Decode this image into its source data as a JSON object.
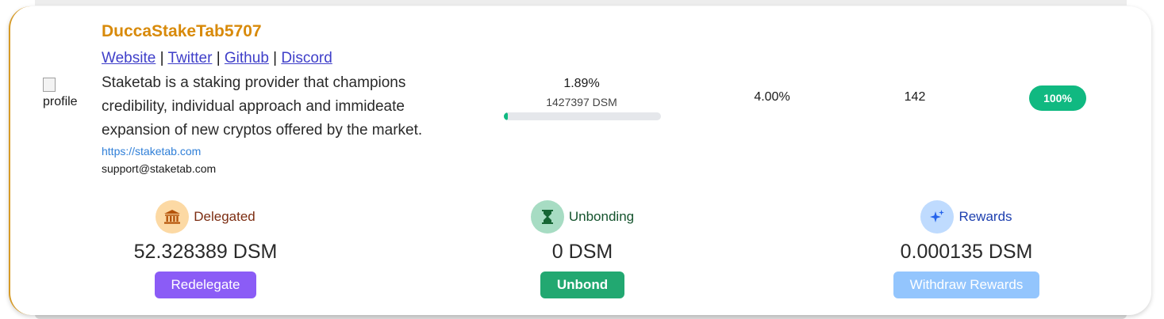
{
  "validator": {
    "profile_alt": "profile",
    "name": "DuccaStakeTab5707",
    "links": {
      "website": "Website",
      "twitter": "Twitter",
      "github": "Github",
      "discord": "Discord",
      "separator": "|"
    },
    "description": "Staketab is a staking provider that champions credibility, individual approach and immideate expansion of new cryptos offered by the market.",
    "site_url": "https://staketab.com",
    "email": "support@staketab.com",
    "voting_power_percent": "1.89%",
    "voting_power_amount": "1427397 DSM",
    "voting_power_fill": 0.0189,
    "commission": "4.00%",
    "votes": "142",
    "uptime": "100%"
  },
  "stats": {
    "delegated": {
      "label": "Delegated",
      "value": "52.328389 DSM",
      "button": "Redelegate",
      "icon": "bank-icon",
      "color": "#7c2d12"
    },
    "unbonding": {
      "label": "Unbonding",
      "value": "0 DSM",
      "button": "Unbond",
      "icon": "hourglass-icon",
      "color": "#14532d"
    },
    "rewards": {
      "label": "Rewards",
      "value": "0.000135 DSM",
      "button": "Withdraw Rewards",
      "icon": "sparkles-icon",
      "color": "#1e40af"
    }
  },
  "colors": {
    "accent_name": "#d88a0a",
    "card_border": "#d69a26",
    "uptime_badge": "#10b981",
    "redelegate_button": "#8b5cf6",
    "unbond_button": "#22a871",
    "withdraw_button": "#93c5fd"
  }
}
